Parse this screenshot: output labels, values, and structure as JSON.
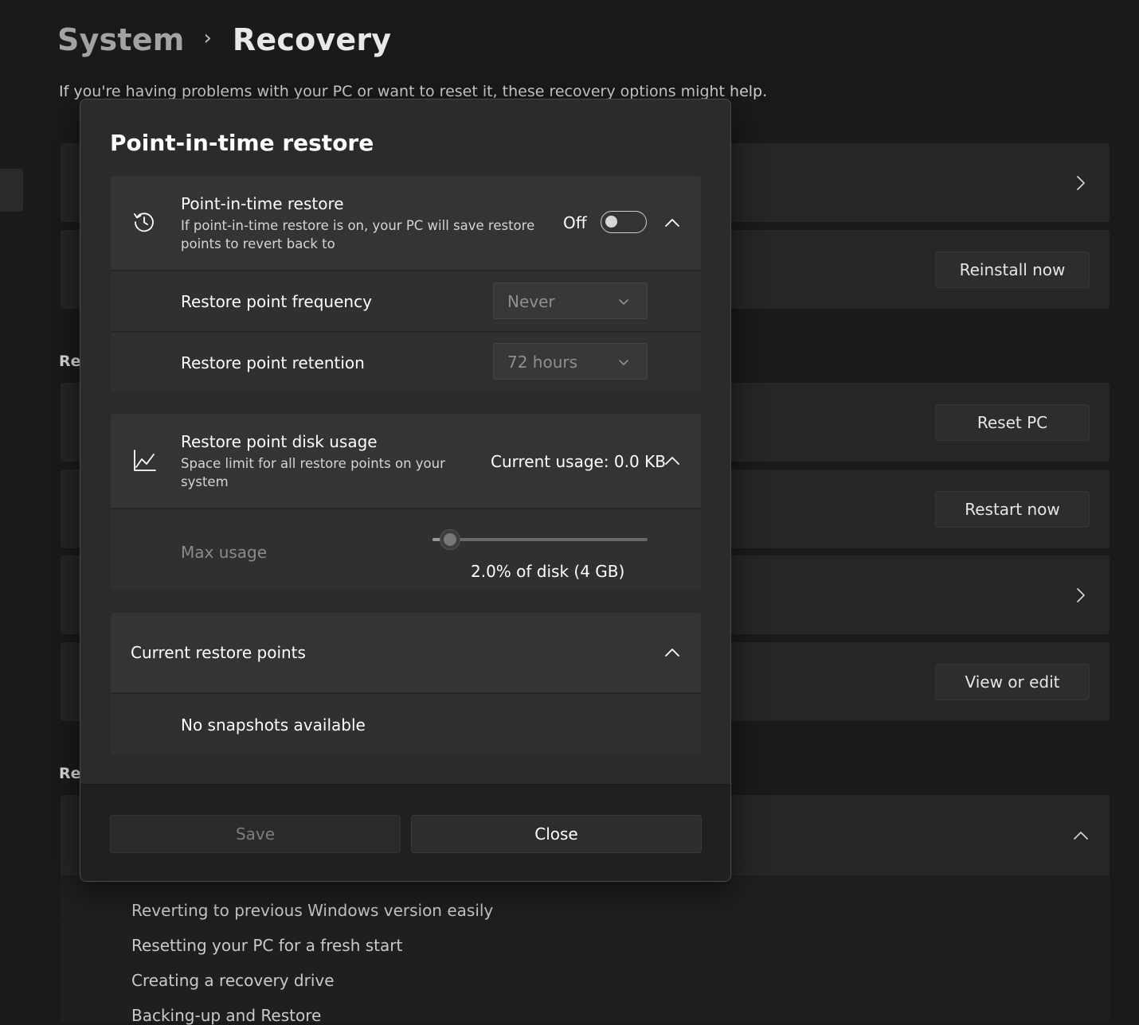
{
  "page": {
    "breadcrumb_parent": "System",
    "breadcrumb_separator": "›",
    "breadcrumb_current": "Recovery",
    "subtitle": "If you're having problems with your PC or want to reset it, these recovery options might help.",
    "section_label_1": "Re",
    "section_label_2": "Re",
    "buttons": {
      "reinstall": "Reinstall now",
      "reset": "Reset PC",
      "restart": "Restart now",
      "view_edit": "View or edit"
    },
    "help_links": [
      "Reverting to previous Windows version easily",
      "Resetting your PC for a fresh start",
      "Creating a recovery drive",
      "Backing-up and Restore"
    ]
  },
  "dialog": {
    "title": "Point-in-time restore",
    "restore": {
      "title": "Point-in-time restore",
      "description": "If point-in-time restore is on, your PC will save restore points to revert back to",
      "toggle_label": "Off",
      "toggle_on": false,
      "icon": "history-icon",
      "frequency_label": "Restore point frequency",
      "frequency_value": "Never",
      "retention_label": "Restore point retention",
      "retention_value": "72 hours"
    },
    "disk": {
      "title": "Restore point disk usage",
      "description": "Space limit for all restore points on your system",
      "current_usage": "Current usage: 0.0 KB",
      "icon": "chart-line-icon",
      "max_label": "Max usage",
      "slider_value_text": "2.0% of disk (4 GB)",
      "slider_fraction": 0.08
    },
    "points": {
      "title": "Current restore points",
      "empty_text": "No snapshots available"
    },
    "save_label": "Save",
    "close_label": "Close"
  },
  "colors": {
    "background": "#1a1a1a",
    "card": "#262626",
    "dialog": "#2b2b2b",
    "row": "#343434"
  }
}
